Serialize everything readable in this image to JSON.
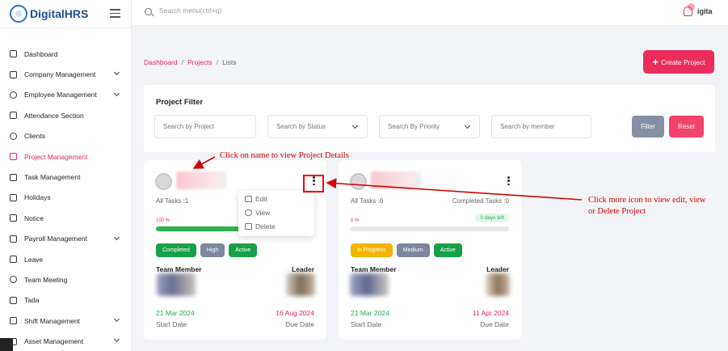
{
  "app": {
    "name": "DigitalHRS",
    "user": "igita"
  },
  "search": {
    "placeholder": "Search menu(ctrl+q)"
  },
  "sidebar": {
    "items": [
      {
        "label": "Dashboard",
        "icon": "cube-icon",
        "expand": false
      },
      {
        "label": "Company Management",
        "icon": "list-icon",
        "expand": true
      },
      {
        "label": "Employee Management",
        "icon": "users-icon",
        "expand": true
      },
      {
        "label": "Attendance Section",
        "icon": "calendar-icon",
        "expand": false
      },
      {
        "label": "Clients",
        "icon": "heart-icon",
        "expand": false
      },
      {
        "label": "Project Management",
        "icon": "cube-icon",
        "expand": false,
        "active": true
      },
      {
        "label": "Task Management",
        "icon": "table-icon",
        "expand": false
      },
      {
        "label": "Holidays",
        "icon": "calendar-icon",
        "expand": false
      },
      {
        "label": "Notice",
        "icon": "calendar-icon",
        "expand": false
      },
      {
        "label": "Payroll Management",
        "icon": "gift-icon",
        "expand": true
      },
      {
        "label": "Leave",
        "icon": "bookmark-icon",
        "expand": false
      },
      {
        "label": "Team Meeting",
        "icon": "globe-icon",
        "expand": false
      },
      {
        "label": "Tada",
        "icon": "document-icon",
        "expand": false
      },
      {
        "label": "Shift Management",
        "icon": "calendar-icon",
        "expand": true
      },
      {
        "label": "Asset Management",
        "icon": "calendar-icon",
        "expand": true
      }
    ]
  },
  "breadcrumb": [
    "Dashboard",
    "Projects",
    "Lists"
  ],
  "create_button": "Create Project",
  "filter": {
    "title": "Project Filter",
    "project_placeholder": "Search by Project",
    "status_placeholder": "Search by Status",
    "priority_placeholder": "Search By Priority",
    "member_placeholder": "Search by member",
    "filter_button": "Filter",
    "reset_button": "Reset"
  },
  "projects": [
    {
      "tasks_label": "All Tasks :1",
      "completed_label": "",
      "progress": 100,
      "progress_label": "100 %",
      "days_left": "",
      "badges": [
        {
          "label": "Completed",
          "color": "#18a048"
        },
        {
          "label": "High",
          "color": "#7d879c"
        },
        {
          "label": "Active",
          "color": "#18a048"
        }
      ],
      "team_member_label": "Team Member",
      "leader_label": "Leader",
      "start_date": "21 Mar 2024",
      "due_date": "16 Aug 2024",
      "start_label": "Start Date",
      "due_label": "Due Date"
    },
    {
      "tasks_label": "All Tasks :0",
      "completed_label": "Completed Tasks :0",
      "progress": 0,
      "progress_label": "0 %",
      "days_left": "0 days left",
      "badges": [
        {
          "label": "In Progress",
          "color": "#f4b400"
        },
        {
          "label": "Medium",
          "color": "#7d879c"
        },
        {
          "label": "Active",
          "color": "#18a048"
        }
      ],
      "team_member_label": "Team Member",
      "leader_label": "Leader",
      "start_date": "21 Mar 2024",
      "due_date": "11 Apr 2024",
      "start_label": "Start Date",
      "due_label": "Due Date"
    }
  ],
  "action_menu": {
    "edit": "Edit",
    "view": "View",
    "delete": "Delete"
  },
  "annotations": {
    "name_hint": "Click on name to view Project Details",
    "more_hint_line1": "Click more icon to view edit, view",
    "more_hint_line2": "or Delete Project"
  },
  "colors": {
    "accent": "#e8245b",
    "success": "#18a048",
    "annotation": "#d10000"
  }
}
